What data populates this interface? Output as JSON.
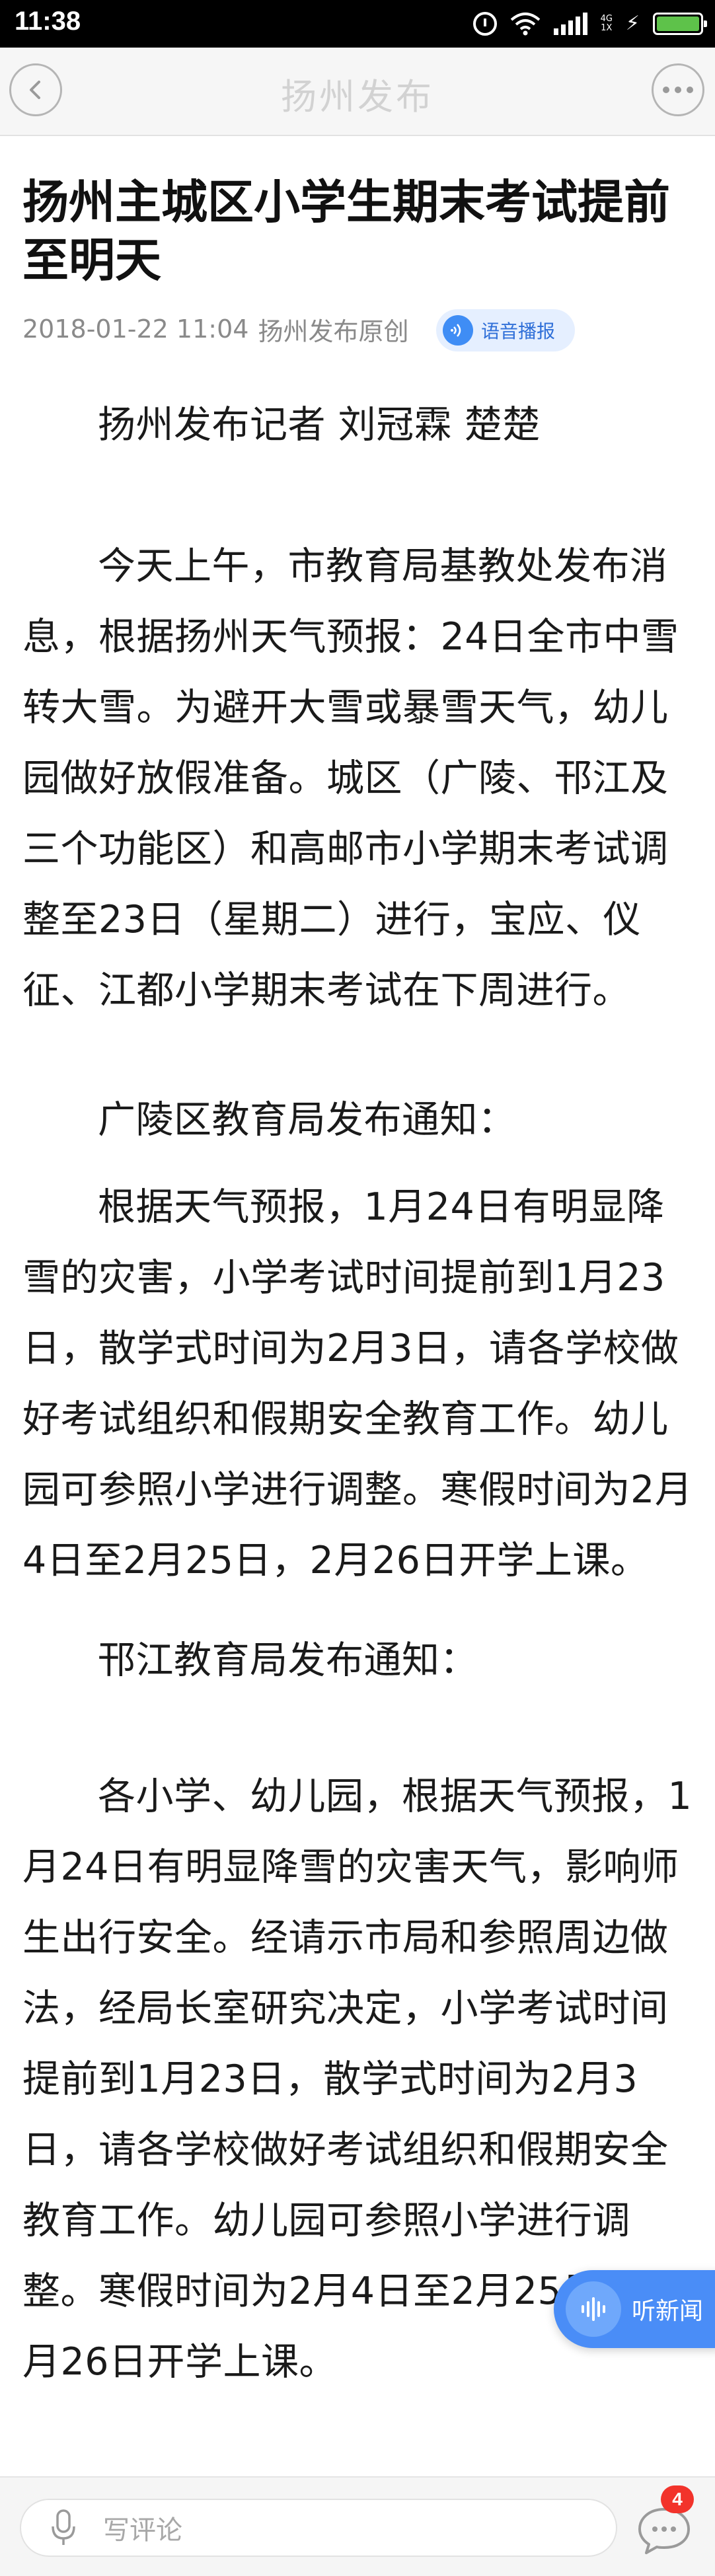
{
  "status_bar": {
    "time": "11:38",
    "network": "4G",
    "icons": [
      "alarm-icon",
      "wifi-icon",
      "signal-icon",
      "battery-icon"
    ]
  },
  "nav": {
    "title": "扬州发布",
    "back_icon": "chevron-left-icon",
    "more_icon": "more-dots-icon"
  },
  "article": {
    "headline": "扬州主城区小学生期末考试提前至明天",
    "date": "2018-01-22 11:04",
    "source": "扬州发布原创",
    "voice_label": "语音播报",
    "paragraphs": [
      "扬州发布记者 刘冠霖 楚楚",
      "今天上午，市教育局基教处发布消息，根据扬州天气预报：24日全市中雪转大雪。为避开大雪或暴雪天气，幼儿园做好放假准备。城区（广陵、邗江及三个功能区）和高邮市小学期末考试调整至23日（星期二）进行，宝应、仪征、江都小学期末考试在下周进行。",
      "广陵区教育局发布通知：",
      "根据天气预报，1月24日有明显降雪的灾害，小学考试时间提前到1月23日，散学式时间为2月3日，请各学校做好考试组织和假期安全教育工作。幼儿园可参照小学进行调整。寒假时间为2月4日至2月25日，2月26日开学上课。",
      "邗江教育局发布通知：",
      "各小学、幼儿园，根据天气预报，1月24日有明显降雪的灾害天气，影响师生出行安全。经请示市局和参照周边做法，经局长室研究决定，小学考试时间提前到1月23日，散学式时间为2月3日，请各学校做好考试组织和假期安全教育工作。幼儿园可参照小学进行调整。寒假时间为2月4日至2月25日，2月26日开学上课。"
    ]
  },
  "floating": {
    "listen_label": "听新闻"
  },
  "bottom_bar": {
    "comment_placeholder": "写评论",
    "comment_count": "4"
  },
  "colors": {
    "accent_blue": "#4a8df7",
    "badge_red": "#f2332b",
    "nav_bg": "#f6f6f6",
    "text": "#1a1a1a",
    "meta_gray": "#8a8a8a"
  }
}
